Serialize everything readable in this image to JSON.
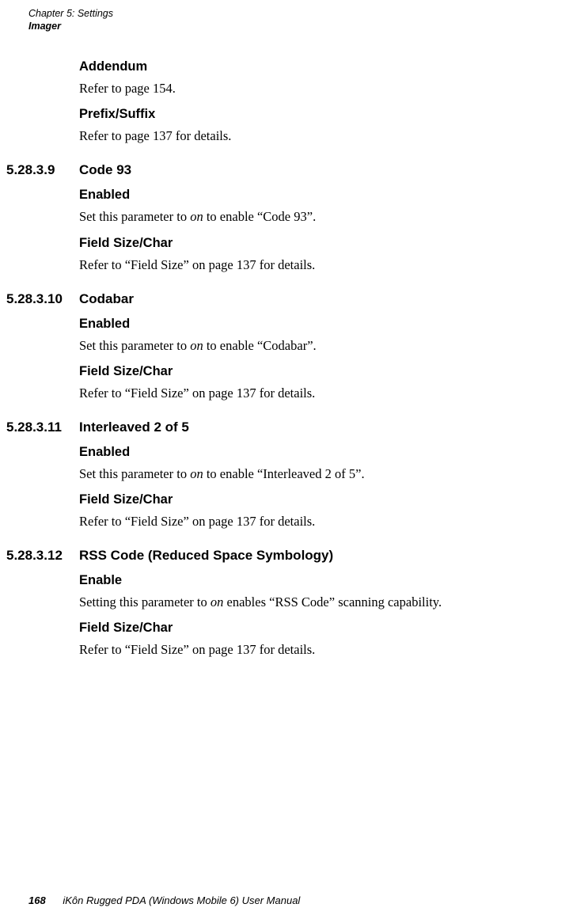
{
  "header": {
    "chapter": "Chapter 5:  Settings",
    "section": "Imager"
  },
  "intro": {
    "addendum_title": "Addendum",
    "addendum_body": "Refer to page 154.",
    "prefix_title": "Prefix/Suffix",
    "prefix_body": "Refer to page 137 for details."
  },
  "sec1": {
    "num": "5.28.3.9",
    "title": "Code 93",
    "enabled_title": "Enabled",
    "enabled_body_pre": "Set this parameter to ",
    "enabled_body_ital": "on",
    "enabled_body_post": " to enable “Code 93”.",
    "field_title": "Field Size/Char",
    "field_body": "Refer to “Field Size” on page 137 for details."
  },
  "sec2": {
    "num": "5.28.3.10",
    "title": "Codabar",
    "enabled_title": "Enabled",
    "enabled_body_pre": "Set this parameter to ",
    "enabled_body_ital": "on",
    "enabled_body_post": " to enable “Codabar”.",
    "field_title": "Field Size/Char",
    "field_body": "Refer to “Field Size” on page 137 for details."
  },
  "sec3": {
    "num": "5.28.3.11",
    "title": "Interleaved 2 of 5",
    "enabled_title": "Enabled",
    "enabled_body_pre": "Set this parameter to ",
    "enabled_body_ital": "on",
    "enabled_body_post": " to enable “Interleaved 2 of 5”.",
    "field_title": "Field Size/Char",
    "field_body": "Refer to “Field Size” on page 137 for details."
  },
  "sec4": {
    "num": "5.28.3.12",
    "title": "RSS Code (Reduced Space Symbology)",
    "enabled_title": "Enable",
    "enabled_body_pre": "Setting this parameter to ",
    "enabled_body_ital": "on",
    "enabled_body_post": " enables “RSS Code” scanning capability.",
    "field_title": "Field Size/Char",
    "field_body": "Refer to “Field Size” on page 137 for details."
  },
  "footer": {
    "pagenum": "168",
    "booktitle": "iKôn Rugged PDA (Windows Mobile 6) User Manual"
  }
}
